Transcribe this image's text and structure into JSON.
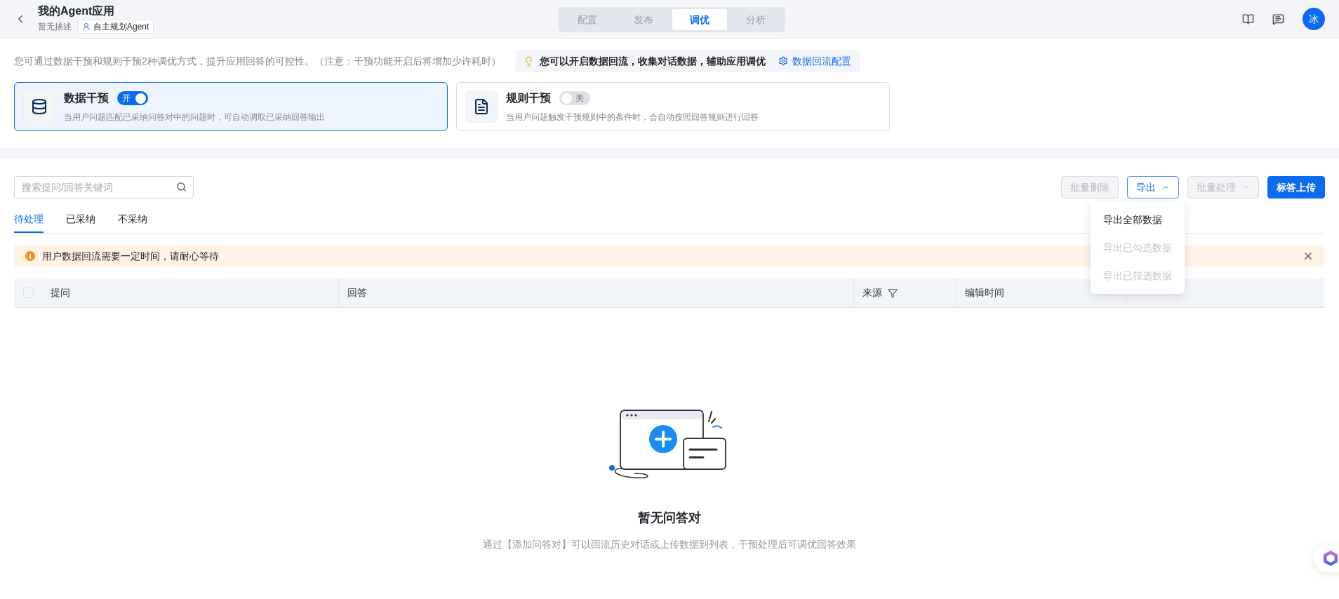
{
  "header": {
    "title": "我的Agent应用",
    "description": "暂无描述",
    "badge": "自主规划Agent",
    "avatar": "冰",
    "mode_tabs": [
      {
        "label": "配置",
        "selected": false
      },
      {
        "label": "发布",
        "selected": false
      },
      {
        "label": "调优",
        "selected": true
      },
      {
        "label": "分析",
        "selected": false
      }
    ]
  },
  "intro": {
    "text": "您可通过数据干预和规则干预2种调优方式，提升应用回答的可控性。（注意：干预功能开启后将增加少许耗时）",
    "tip": "您可以开启数据回流，收集对话数据，辅助应用调优",
    "tip_link": "数据回流配置"
  },
  "interventions": [
    {
      "kind": "data",
      "title": "数据干预",
      "toggle_label": "开",
      "on": true,
      "selected": true,
      "description": "当用户问题匹配已采纳问答对中的问题时，可自动调取已采纳回答输出"
    },
    {
      "kind": "rule",
      "title": "规则干预",
      "toggle_label": "关",
      "on": false,
      "selected": false,
      "description": "当用户问题触发干预规则中的条件时，会自动按照回答规则进行回答"
    }
  ],
  "toolbar": {
    "search_placeholder": "搜索提问/回答关键词",
    "buttons": [
      {
        "kind": "plain",
        "label": "批量删除",
        "disabled": true
      },
      {
        "kind": "dropdown",
        "label": "导出",
        "disabled": false,
        "expanded": true
      },
      {
        "kind": "dropdown",
        "label": "批量处理",
        "disabled": true,
        "expanded": false
      },
      {
        "kind": "primary",
        "label": "标答上传",
        "disabled": false
      }
    ]
  },
  "export_menu": [
    {
      "label": "导出全部数据",
      "disabled": false
    },
    {
      "label": "导出已勾选数据",
      "disabled": true
    },
    {
      "label": "导出已筛选数据",
      "disabled": true
    }
  ],
  "status_tabs": [
    {
      "label": "待处理",
      "selected": true
    },
    {
      "label": "已采纳",
      "selected": false
    },
    {
      "label": "不采纳",
      "selected": false
    }
  ],
  "alert": {
    "text": "用户数据回流需要一定时间，请耐心等待"
  },
  "table": {
    "select_all": {
      "checked": false
    },
    "columns": [
      {
        "label": "提问",
        "filter": false
      },
      {
        "label": "回答",
        "filter": false
      },
      {
        "label": "来源",
        "filter": true
      },
      {
        "label": "编辑时间",
        "filter": false
      }
    ]
  },
  "empty": {
    "title": "暂无问答对",
    "description": "通过【添加问答对】可以回流历史对话或上传数据到列表，干预处理后可调优回答效果"
  }
}
